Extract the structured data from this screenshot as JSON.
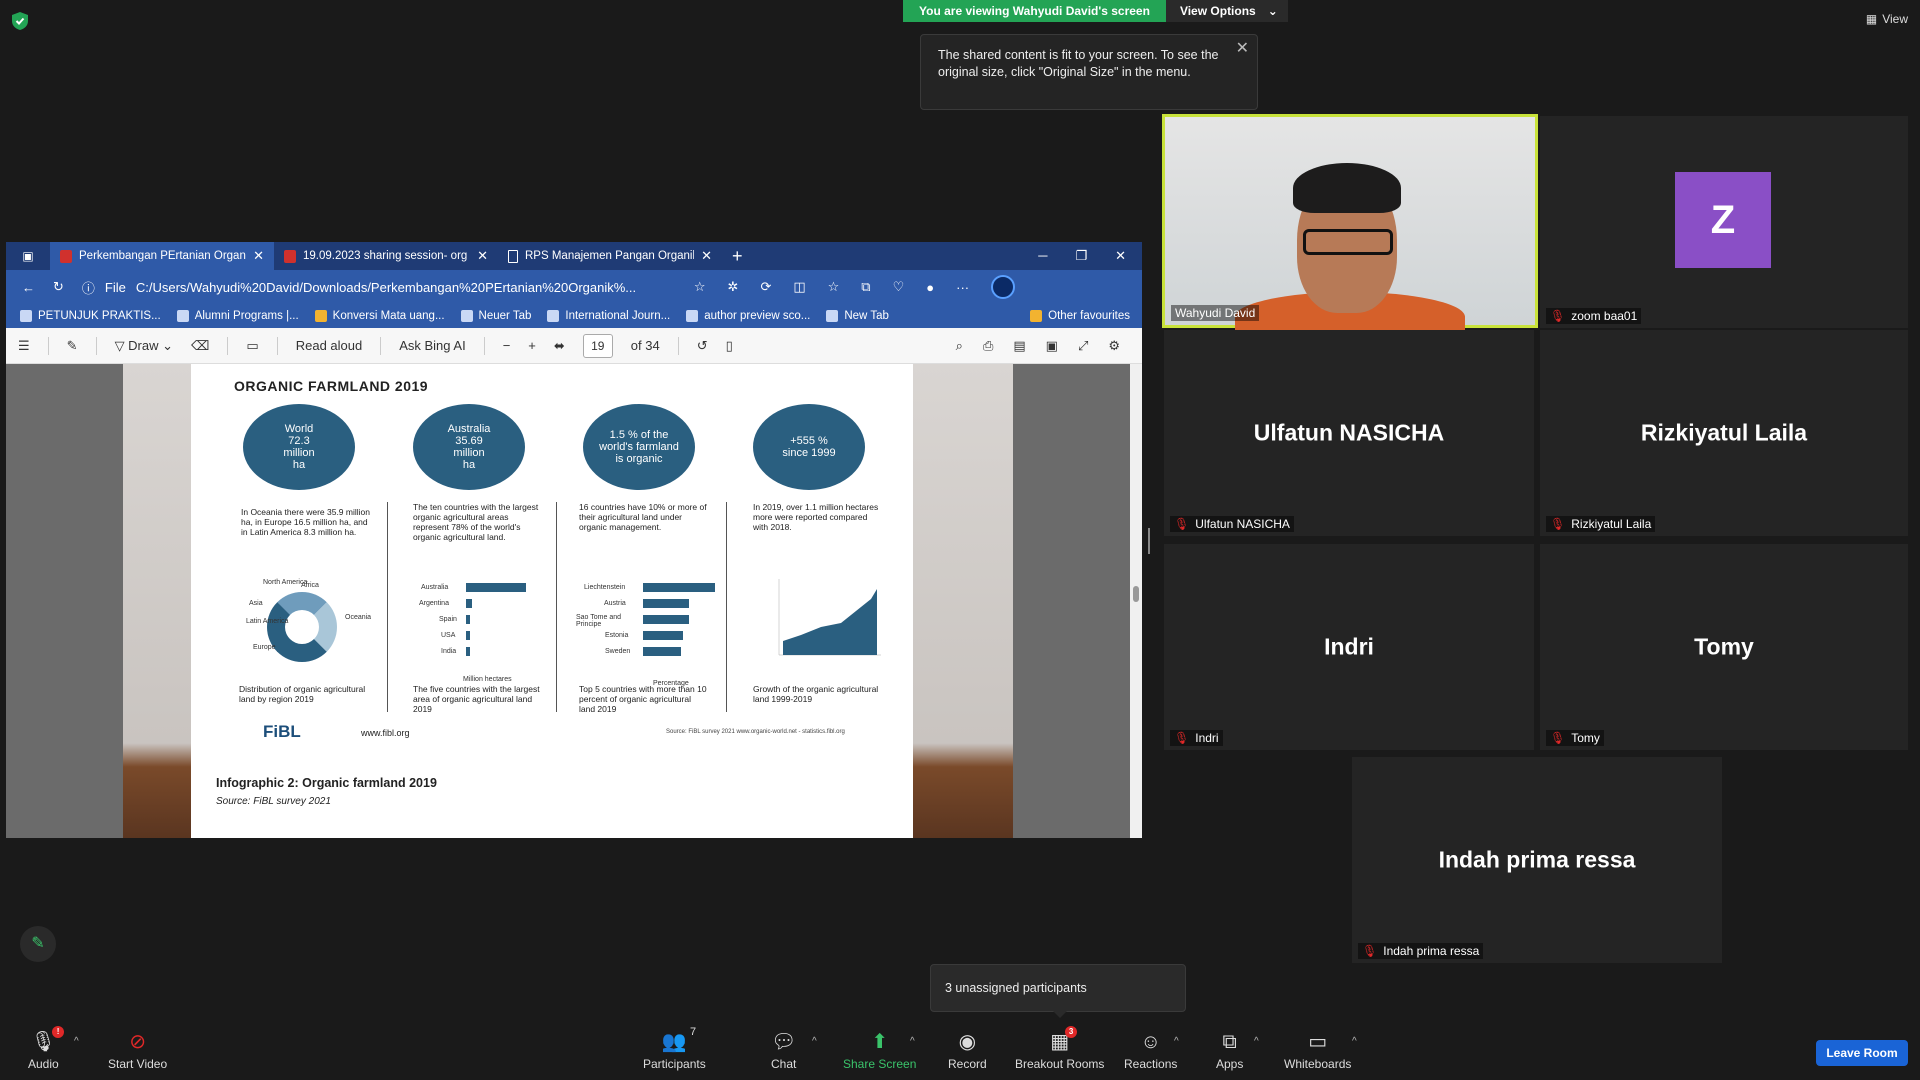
{
  "banner": {
    "viewing": "You are viewing Wahyudi David's screen",
    "view_options": "View Options",
    "view": "View"
  },
  "tooltip": {
    "text": "The shared content is fit to your screen. To see the original size, click \"Original Size\" in the menu."
  },
  "browser": {
    "tabs": [
      {
        "label": "Perkembangan PErtanian Organi"
      },
      {
        "label": "19.09.2023 sharing session- org"
      },
      {
        "label": "RPS Manajemen Pangan Organik"
      }
    ],
    "address": {
      "scheme": "File",
      "url": "C:/Users/Wahyudi%20David/Downloads/Perkembangan%20PErtanian%20Organik%..."
    },
    "favourites": [
      {
        "label": "PETUNJUK PRAKTIS..."
      },
      {
        "label": "Alumni Programs |..."
      },
      {
        "label": "Konversi Mata uang..."
      },
      {
        "label": "Neuer Tab"
      },
      {
        "label": "International Journ..."
      },
      {
        "label": "author preview sco..."
      },
      {
        "label": "New Tab"
      }
    ],
    "other_favourites": "Other favourites",
    "pdf_toolbar": {
      "draw": "Draw",
      "read_aloud": "Read aloud",
      "ask_bing": "Ask Bing AI",
      "page": "19",
      "of_pages": "of 34"
    }
  },
  "pdf_page": {
    "title": "ORGANIC FARMLAND 2019",
    "circles": [
      {
        "l1": "World",
        "l2": "72.3",
        "l3": "million",
        "l4": "ha"
      },
      {
        "l1": "Australia",
        "l2": "35.69",
        "l3": "million",
        "l4": "ha"
      },
      {
        "l1": "1.5 % of the",
        "l2": "world's farmland",
        "l3": "is organic",
        "l4": ""
      },
      {
        "l1": "+555 %",
        "l2": "since 1999",
        "l3": "",
        "l4": ""
      }
    ],
    "texts": [
      "In Oceania there were 35.9 million ha, in Europe 16.5 million ha, and in Latin America 8.3 million ha.",
      "The ten countries with the largest organic agricultural areas represent 78% of the world's organic agricultural land.",
      "16 countries have 10% or more of their agricultural land under organic management.",
      "In 2019, over 1.1 million hectares more were reported compared with 2018."
    ],
    "captions": [
      "Distribution of organic agricultural land by region 2019",
      "The five countries with the largest area of organic agricultural land 2019",
      "Top 5 countries with more than 10 percent of organic agricultural land 2019",
      "Growth of the organic agricultural land 1999-2019"
    ],
    "region_labels": [
      "North America",
      "Africa",
      "Asia",
      "Latin America",
      "Oceania",
      "Europe"
    ],
    "countries_area": [
      "Australia",
      "Argentina",
      "Spain",
      "USA",
      "India"
    ],
    "countries_share": [
      "Liechtenstein",
      "Austria",
      "Sao Tome and Principe",
      "Estonia",
      "Sweden"
    ],
    "axis_million_ha": "Million hectares",
    "axis_percentage": "Percentage",
    "fibl": "FiBL",
    "www": "www.fibl.org",
    "source_small": "Source: FiBL survey 2021   www.organic-world.net - statistics.fibl.org",
    "infographic": "Infographic 2: Organic farmland 2019",
    "infographic_src": "Source: FiBL survey 2021"
  },
  "participants_tiles": [
    {
      "name": "Wahyudi David"
    },
    {
      "name": "zoom baa01",
      "avatar": "Z"
    },
    {
      "name": "Ulfatun NASICHA",
      "big": "Ulfatun NASICHA"
    },
    {
      "name": "Rizkiyatul Laila",
      "big": "Rizkiyatul Laila"
    },
    {
      "name": "Indri",
      "big": "Indri"
    },
    {
      "name": "Tomy",
      "big": "Tomy"
    },
    {
      "name": "Indah prima ressa",
      "big": "Indah prima ressa"
    }
  ],
  "unassigned": "3 unassigned participants",
  "toolbar": {
    "audio": "Audio",
    "audio_badge": "!",
    "start_video": "Start Video",
    "participants": "Participants",
    "participants_count": "7",
    "chat": "Chat",
    "share_screen": "Share Screen",
    "record": "Record",
    "breakout": "Breakout Rooms",
    "breakout_badge": "3",
    "reactions": "Reactions",
    "apps": "Apps",
    "whiteboards": "Whiteboards",
    "leave": "Leave Room"
  },
  "colors": {
    "accent_green": "#23a455",
    "speaker_border": "#c8e23a",
    "leave_blue": "#1a64d6",
    "avatar_purple": "#8a4fc6",
    "edge_bar": "#2f5aa8"
  }
}
